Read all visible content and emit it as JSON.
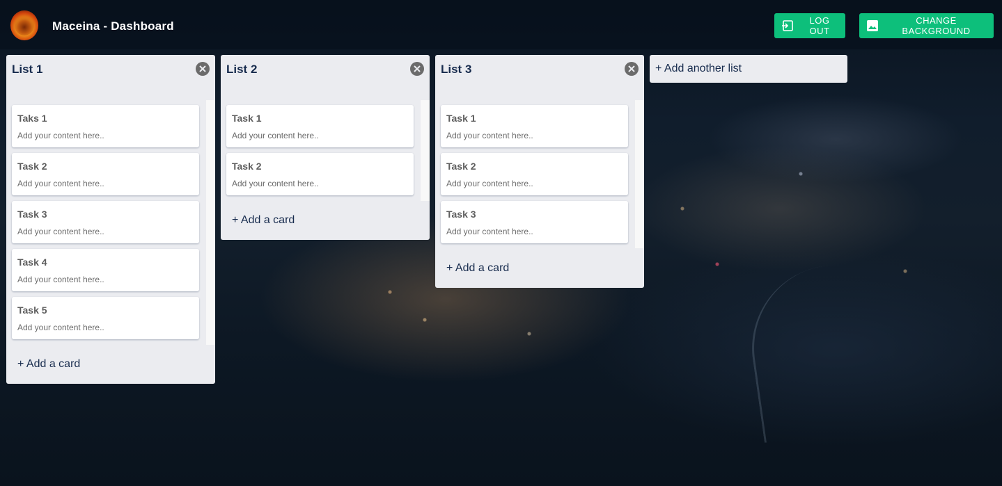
{
  "header": {
    "title": "Maceina - Dashboard",
    "logo": "lion-logo",
    "logout_label": "LOG OUT",
    "change_bg_label": "CHANGE BACKGROUND"
  },
  "colors": {
    "accent": "#0dbf7b",
    "list_bg": "#ebecf0",
    "card_bg": "#ffffff"
  },
  "lists": [
    {
      "title": "List 1",
      "cards": [
        {
          "title": "Taks 1",
          "content": "Add your content here.."
        },
        {
          "title": "Task 2",
          "content": "Add your content here.."
        },
        {
          "title": "Task 3",
          "content": "Add your content here.."
        },
        {
          "title": "Task 4",
          "content": "Add your content here.."
        },
        {
          "title": "Task 5",
          "content": "Add your content here.."
        }
      ],
      "add_card_label": "+ Add a card"
    },
    {
      "title": "List 2",
      "cards": [
        {
          "title": "Task 1",
          "content": "Add your content here.."
        },
        {
          "title": "Task 2",
          "content": "Add your content here.."
        }
      ],
      "add_card_label": "+ Add a card"
    },
    {
      "title": "List 3",
      "cards": [
        {
          "title": "Task 1",
          "content": "Add your content here.."
        },
        {
          "title": "Task 2",
          "content": "Add your content here.."
        },
        {
          "title": "Task 3",
          "content": "Add your content here.."
        }
      ],
      "add_card_label": "+ Add a card"
    }
  ],
  "add_list_label": "+ Add another list"
}
